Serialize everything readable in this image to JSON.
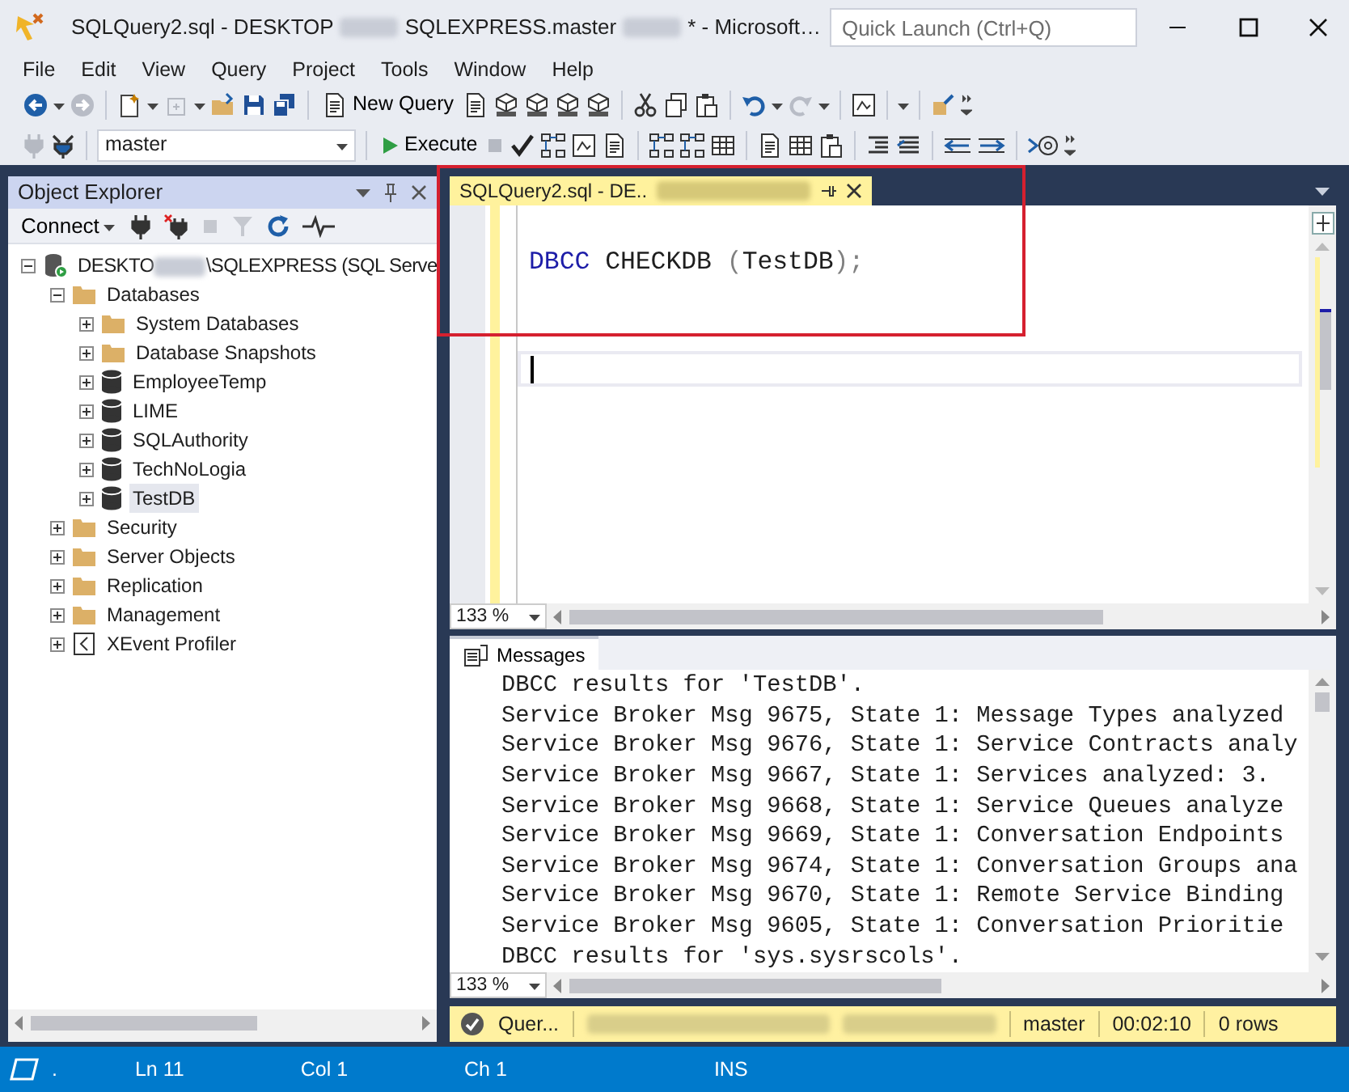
{
  "window": {
    "title": [
      {
        "kind": "text",
        "text": "SQLQuery2.sql - DESKTOP"
      },
      {
        "kind": "redacted"
      },
      {
        "kind": "text",
        "text": "SQLEXPRESS.master"
      },
      {
        "kind": "redacted"
      },
      {
        "kind": "text",
        "text": "* - Microsoft…"
      }
    ],
    "quick_launch": {
      "placeholder": "Quick Launch (Ctrl+Q)"
    }
  },
  "menu": [
    "File",
    "Edit",
    "View",
    "Query",
    "Project",
    "Tools",
    "Window",
    "Help"
  ],
  "toolbar": {
    "new_query": "New Query",
    "database": "master",
    "execute": "Execute"
  },
  "object_explorer": {
    "title": "Object Explorer",
    "connect": "Connect",
    "tree": [
      {
        "kind": "server",
        "segments": [
          {
            "kind": "text",
            "text": "DESKTO"
          },
          {
            "kind": "redacted"
          },
          {
            "kind": "text",
            "text": "\\SQLEXPRESS (SQL Serve"
          }
        ],
        "expanded": true,
        "selected": false,
        "children": [
          {
            "kind": "folder",
            "label": "Databases",
            "expanded": true,
            "selected": false,
            "children": [
              {
                "kind": "folder",
                "label": "System Databases",
                "expanded": false,
                "selected": false
              },
              {
                "kind": "folder",
                "label": "Database Snapshots",
                "expanded": false,
                "selected": false
              },
              {
                "kind": "database",
                "label": "EmployeeTemp",
                "expanded": false,
                "selected": false
              },
              {
                "kind": "database",
                "label": "LIME",
                "expanded": false,
                "selected": false
              },
              {
                "kind": "database",
                "label": "SQLAuthority",
                "expanded": false,
                "selected": false
              },
              {
                "kind": "database",
                "label": "TechNoLogia",
                "expanded": false,
                "selected": false
              },
              {
                "kind": "database",
                "label": "TestDB",
                "expanded": false,
                "selected": true
              }
            ]
          },
          {
            "kind": "folder",
            "label": "Security",
            "expanded": false,
            "selected": false
          },
          {
            "kind": "folder",
            "label": "Server Objects",
            "expanded": false,
            "selected": false
          },
          {
            "kind": "folder",
            "label": "Replication",
            "expanded": false,
            "selected": false
          },
          {
            "kind": "folder",
            "label": "Management",
            "expanded": false,
            "selected": false
          },
          {
            "kind": "profiler",
            "label": "XEvent Profiler",
            "expanded": false,
            "selected": false
          }
        ]
      }
    ]
  },
  "editor": {
    "tab": {
      "segments": [
        {
          "kind": "text",
          "text": "SQLQuery2.sql - DE.."
        },
        {
          "kind": "redacted"
        }
      ],
      "selected": true
    },
    "code_lines": [
      {
        "tokens": [
          {
            "kind": "keyword",
            "text": "DBCC"
          },
          {
            "kind": "plain",
            "text": " CHECKDB "
          },
          {
            "kind": "punct",
            "text": "("
          },
          {
            "kind": "plain",
            "text": "TestDB"
          },
          {
            "kind": "punct",
            "text": ");"
          }
        ]
      }
    ],
    "zoom": "133 %"
  },
  "results": {
    "tabs": [
      {
        "label": "Messages",
        "selected": true
      }
    ],
    "messages": [
      "DBCC results for 'TestDB'.",
      "Service Broker Msg 9675, State 1: Message Types analyzed",
      "Service Broker Msg 9676, State 1: Service Contracts analy",
      "Service Broker Msg 9667, State 1: Services analyzed: 3.",
      "Service Broker Msg 9668, State 1: Service Queues analyze",
      "Service Broker Msg 9669, State 1: Conversation Endpoints",
      "Service Broker Msg 9674, State 1: Conversation Groups ana",
      "Service Broker Msg 9670, State 1: Remote Service Binding",
      "Service Broker Msg 9605, State 1: Conversation Prioritie",
      "DBCC results for 'sys.sysrscols'."
    ],
    "zoom": "133 %"
  },
  "query_status": {
    "state": "Quer...",
    "segments": [
      {
        "kind": "redacted"
      },
      {
        "kind": "redacted"
      }
    ],
    "database": "master",
    "elapsed": "00:02:10",
    "rows": "0 rows"
  },
  "status_bar": {
    "dot": ".",
    "line": "Ln 11",
    "column": "Col 1",
    "char": "Ch 1",
    "mode": "INS"
  }
}
